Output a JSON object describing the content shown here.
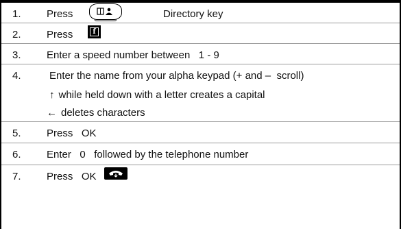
{
  "steps": [
    {
      "num": "1.",
      "text": "Press",
      "after": "Directory key"
    },
    {
      "num": "2.",
      "text": "Press"
    },
    {
      "num": "3.",
      "text": "Enter a speed number between   1 - 9"
    },
    {
      "num": "4.",
      "text": "Enter the name from your alpha keypad (+ and –  scroll)"
    },
    {
      "num": "5.",
      "text": "Press   OK"
    },
    {
      "num": "6.",
      "text": "Enter   0   followed by the telephone number"
    },
    {
      "num": "7.",
      "text": "Press   OK"
    }
  ],
  "notes": [
    {
      "icon": "up-arrow-icon",
      "glyph": "↑",
      "text": "while held down with a letter creates a capital"
    },
    {
      "icon": "left-arrow-icon",
      "glyph": "←",
      "text": "deletes characters"
    }
  ],
  "keys": {
    "directory": "directory-key-icon",
    "function": "function-key-icon",
    "function_letter": "f",
    "hangup": "hangup-key-icon"
  }
}
